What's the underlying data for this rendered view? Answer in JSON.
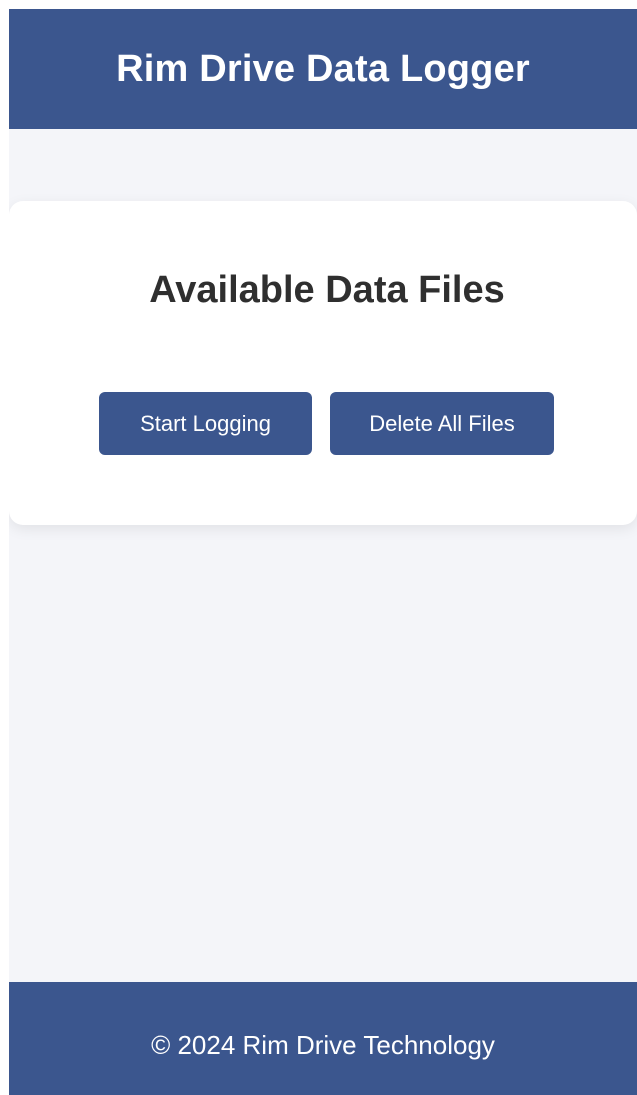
{
  "header": {
    "title": "Rim Drive Data Logger"
  },
  "card": {
    "title": "Available Data Files",
    "start_button_label": "Start Logging",
    "delete_button_label": "Delete All Files"
  },
  "footer": {
    "text": "© 2024 Rim Drive Technology"
  },
  "colors": {
    "primary": "#3b568e",
    "background": "#f4f5f9",
    "card": "#ffffff",
    "title_text": "#2f2f2f"
  }
}
